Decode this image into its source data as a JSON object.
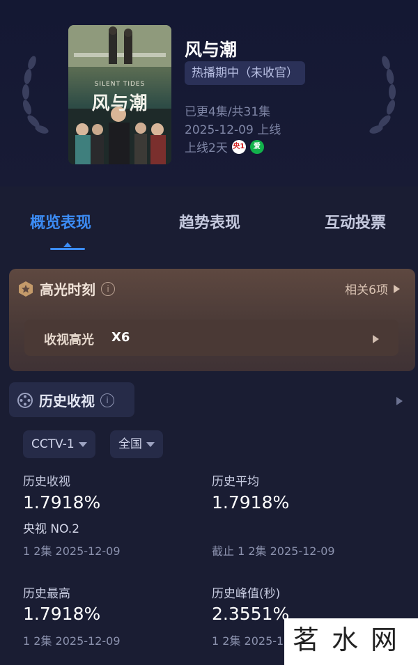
{
  "show": {
    "title": "风与潮",
    "status": "热播期中（未收官）",
    "episodes": "已更4集/共31集",
    "air_date": "2025-12-09 上线",
    "days_online": "上线2天",
    "platforms": [
      {
        "label": "央1",
        "icon": "cctv1-icon"
      },
      {
        "label": "iQIYI",
        "icon": "iqiyi-icon"
      }
    ],
    "poster": {
      "en_title": "SILENT TIDES",
      "cn_title": "风与潮"
    }
  },
  "tabs": [
    {
      "label": "概览表现",
      "active": true
    },
    {
      "label": "趋势表现",
      "active": false
    },
    {
      "label": "互动投票",
      "active": false
    }
  ],
  "highlights": {
    "title": "高光时刻",
    "info": "i",
    "related": "相关6项",
    "row_label": "收视高光",
    "row_count": "X6"
  },
  "history": {
    "title": "历史收视",
    "info": "i",
    "channel": "CCTV-1",
    "region": "全国",
    "stats": [
      {
        "label": "历史收视",
        "value": "1.7918%",
        "rank": "央视 NO.2",
        "sub": "1 2集 2025-12-09"
      },
      {
        "label": "历史平均",
        "value": "1.7918%",
        "sub": "截止 1 2集 2025-12-09"
      },
      {
        "label": "历史最高",
        "value": "1.7918%",
        "sub": "1 2集 2025-12-09"
      },
      {
        "label": "历史峰值(秒)",
        "value": "2.3551%",
        "sub": "1 2集 2025-12-09"
      }
    ]
  },
  "watermark": {
    "text": "茗水网"
  },
  "colors": {
    "accent": "#3c8cf5",
    "background": "#1a1d33",
    "highlight_card": "#5e4840"
  }
}
